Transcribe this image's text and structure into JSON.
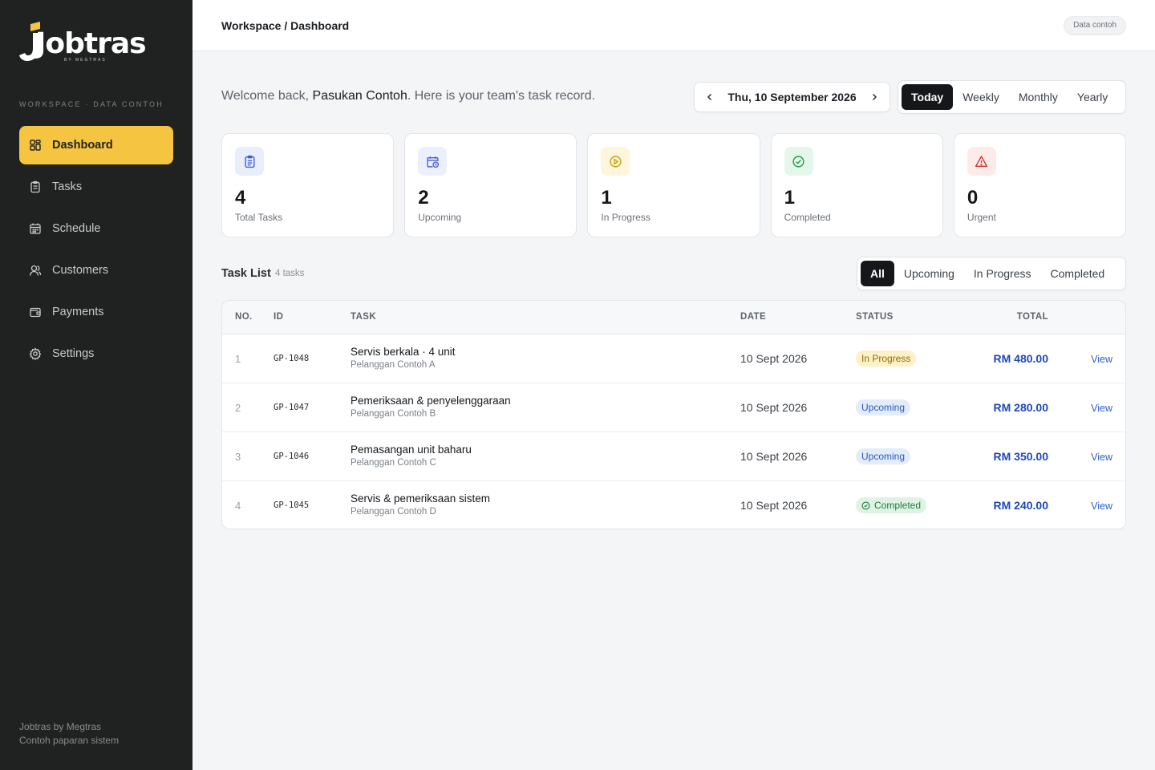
{
  "brand": {
    "name": "Jobtras",
    "tagline": "BY MEGTRAS"
  },
  "sidebar": {
    "workspace_label": "WORKSPACE · DATA CONTOH",
    "items": [
      {
        "label": "Dashboard",
        "icon": "dashboard-icon",
        "active": true
      },
      {
        "label": "Tasks",
        "icon": "clipboard-icon"
      },
      {
        "label": "Schedule",
        "icon": "calendar-icon"
      },
      {
        "label": "Customers",
        "icon": "users-icon"
      },
      {
        "label": "Payments",
        "icon": "wallet-icon"
      },
      {
        "label": "Settings",
        "icon": "gear-icon"
      }
    ],
    "footer_line1": "Jobtras by Megtras",
    "footer_line2": "Contoh paparan sistem"
  },
  "header": {
    "breadcrumb": "Workspace / Dashboard",
    "badge": "Data contoh"
  },
  "welcome": {
    "prefix": "Welcome back, ",
    "name": "Pasukan Contoh",
    "suffix": ". Here is your team's task record."
  },
  "date_nav": {
    "date": "Thu, 10 September 2026"
  },
  "period": {
    "options": [
      "Today",
      "Weekly",
      "Monthly",
      "Yearly"
    ],
    "selected": "Today"
  },
  "stats": [
    {
      "value": "4",
      "label": "Total Tasks",
      "icon": "clipboard-icon",
      "color": "#3b5bdb",
      "bg": "#e8eefc"
    },
    {
      "value": "2",
      "label": "Upcoming",
      "icon": "calendar-clock-icon",
      "color": "#4c5fd5",
      "bg": "#eceffd"
    },
    {
      "value": "1",
      "label": "In Progress",
      "icon": "play-circle-icon",
      "color": "#c9a00f",
      "bg": "#fdf6dc"
    },
    {
      "value": "1",
      "label": "Completed",
      "icon": "check-circle-icon",
      "color": "#1f9a4a",
      "bg": "#e5f6ea"
    },
    {
      "value": "0",
      "label": "Urgent",
      "icon": "alert-triangle-icon",
      "color": "#d0342c",
      "bg": "#fdebea"
    }
  ],
  "task_list": {
    "title": "Task List",
    "count": "4 tasks",
    "filters": [
      "All",
      "Upcoming",
      "In Progress",
      "Completed"
    ],
    "selected_filter": "All",
    "columns": {
      "no": "NO.",
      "id": "ID",
      "task": "TASK",
      "date": "DATE",
      "status": "STATUS",
      "total": "TOTAL"
    },
    "rows": [
      {
        "no": "1",
        "id": "GP-1048",
        "task": "Servis berkala · 4 unit",
        "customer": "Pelanggan Contoh A",
        "date": "10 Sept 2026",
        "status": "In Progress",
        "status_key": "inprogress",
        "total": "RM 480.00",
        "action": "View"
      },
      {
        "no": "2",
        "id": "GP-1047",
        "task": "Pemeriksaan & penyelenggaraan",
        "customer": "Pelanggan Contoh B",
        "date": "10 Sept 2026",
        "status": "Upcoming",
        "status_key": "upcoming",
        "total": "RM 280.00",
        "action": "View"
      },
      {
        "no": "3",
        "id": "GP-1046",
        "task": "Pemasangan unit baharu",
        "customer": "Pelanggan Contoh C",
        "date": "10 Sept 2026",
        "status": "Upcoming",
        "status_key": "upcoming",
        "total": "RM 350.00",
        "action": "View"
      },
      {
        "no": "4",
        "id": "GP-1045",
        "task": "Servis & pemeriksaan sistem",
        "customer": "Pelanggan Contoh D",
        "date": "10 Sept 2026",
        "status": "Completed",
        "status_key": "completed",
        "total": "RM 240.00",
        "action": "View"
      }
    ]
  }
}
